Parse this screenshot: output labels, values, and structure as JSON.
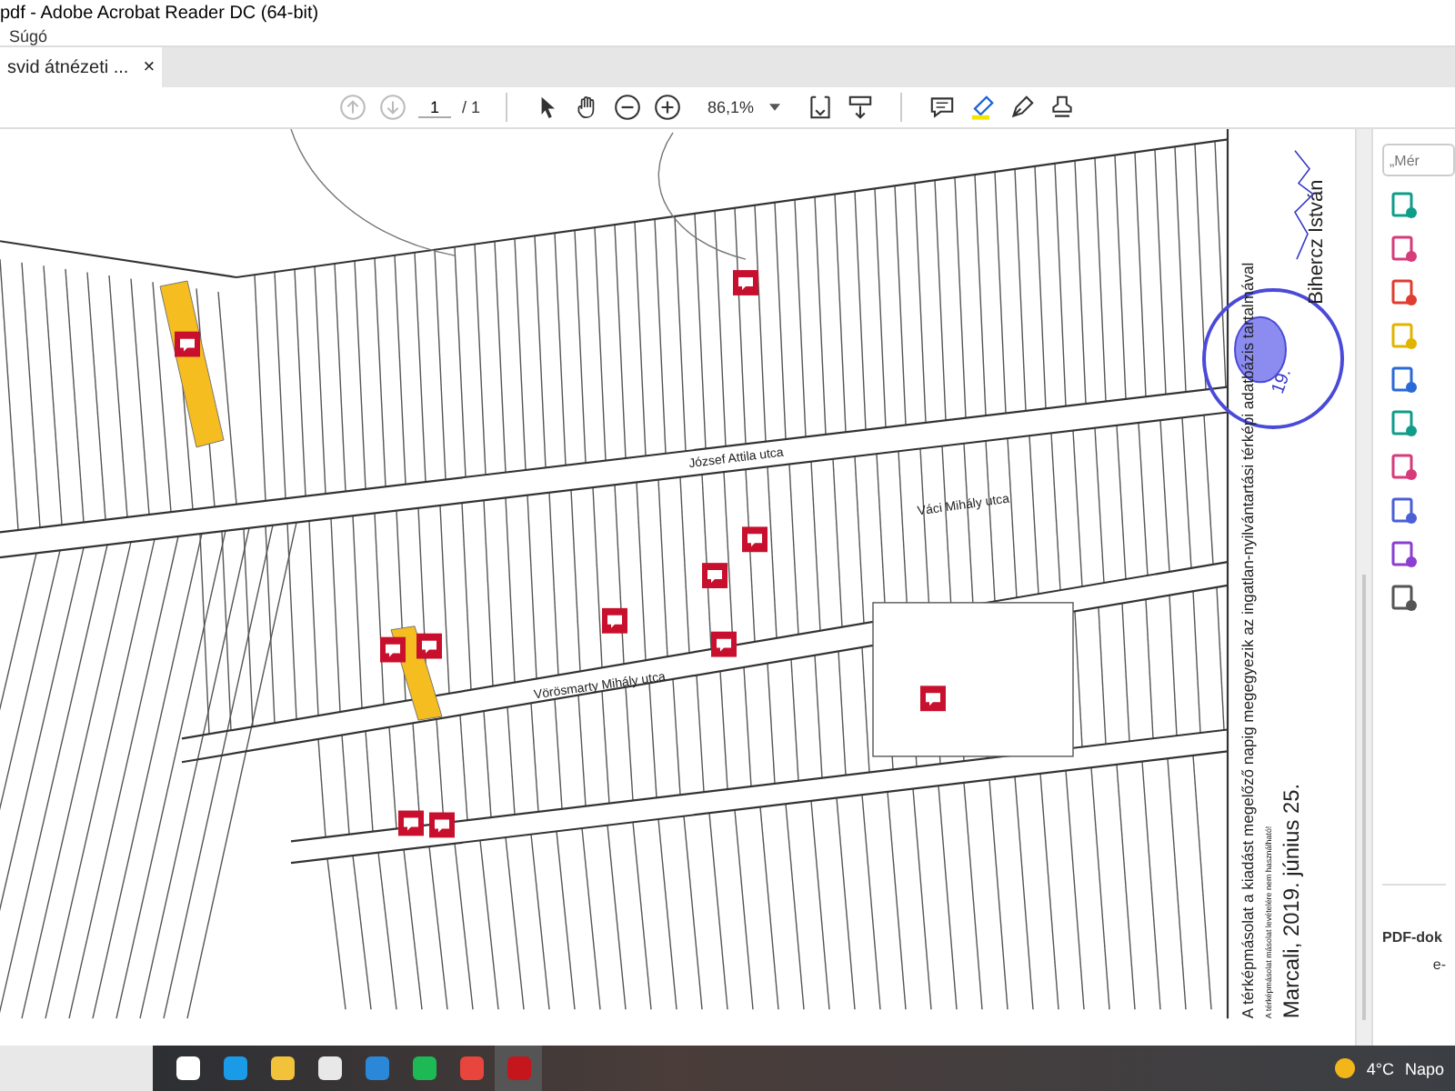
{
  "window": {
    "title": "pdf - Adobe Acrobat Reader DC (64-bit)"
  },
  "menu": [
    "Súgó"
  ],
  "tabs": [
    {
      "label": "svid átnézeti ...",
      "selected": true,
      "close": "×"
    }
  ],
  "toolbar": {
    "page": "1",
    "page_total": "/ 1",
    "zoom": "86,1%"
  },
  "map": {
    "streets": [
      "József Attila utca",
      "Váci Mihály utca",
      "Vörösmarty Mihály utca"
    ],
    "note": "A térképmásolat a kiadást megelőző napig megegyezik az ingatlan-nyilvántartási térképi adatbázis tartalmával",
    "note_small": "A térképmásolat másolat levételére nem használható!",
    "date": "Marcali, 2019. június 25.",
    "signature": "Bihercz István",
    "stamp_number": "19."
  },
  "tools_pane": {
    "search_placeholder": "„Mér",
    "footer_title": "PDF-dok",
    "footer_text": "e-"
  },
  "taskbar": {
    "temperature": "4°C",
    "weather": "Napo"
  }
}
